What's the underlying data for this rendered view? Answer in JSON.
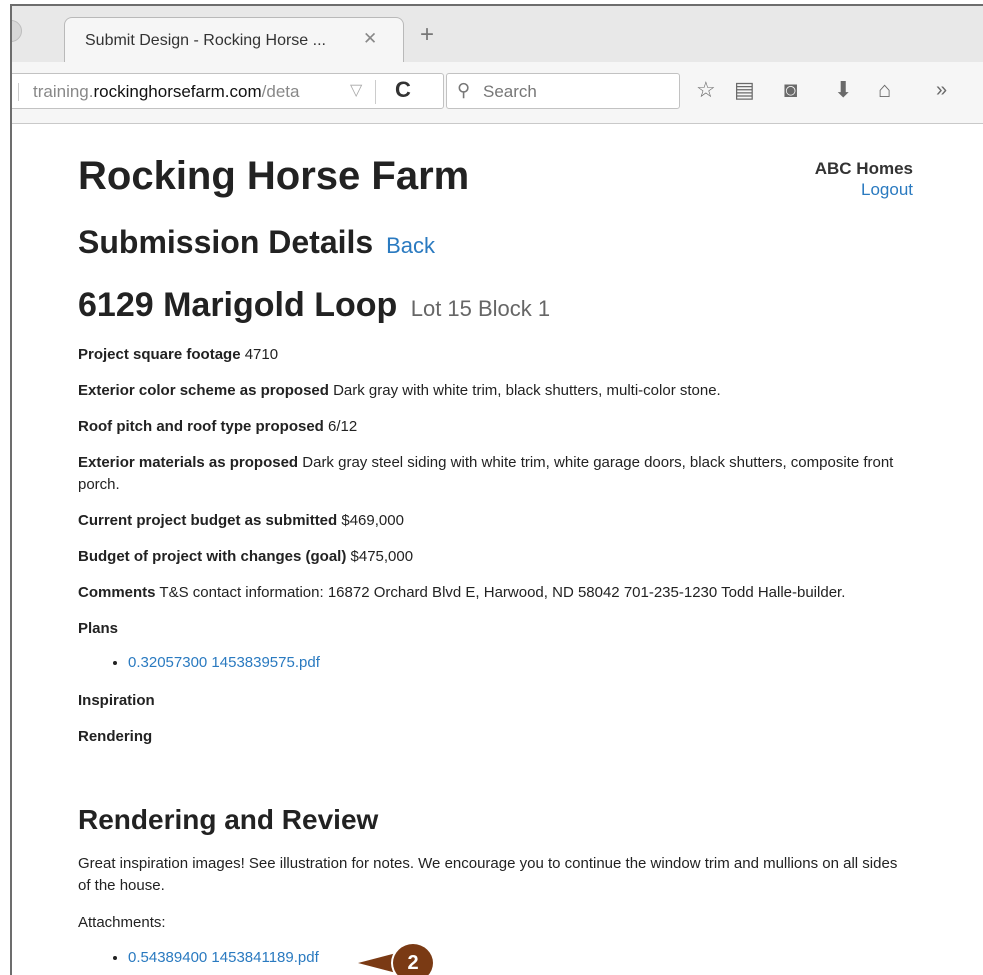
{
  "browser": {
    "tab_title": "Submit Design - Rocking Horse ...",
    "tab_close": "✕",
    "new_tab": "+",
    "url_prefix": "training.",
    "url_domain": "rockinghorsefarm.com",
    "url_suffix": "/deta",
    "search_placeholder": "Search",
    "more": "»"
  },
  "header": {
    "site_title": "Rocking Horse Farm",
    "user_name": "ABC Homes",
    "logout_label": "Logout"
  },
  "submission": {
    "heading": "Submission Details",
    "back_label": "Back",
    "address": "6129 Marigold Loop",
    "lot": "Lot 15 Block 1"
  },
  "fields": [
    {
      "label": "Project square footage",
      "value": "4710"
    },
    {
      "label": "Exterior color scheme as proposed",
      "value": "Dark gray with white trim, black shutters, multi-color stone."
    },
    {
      "label": "Roof pitch and roof type proposed",
      "value": "6/12"
    },
    {
      "label": "Exterior materials as proposed",
      "value": "Dark gray steel siding with white trim, white garage doors, black shutters, composite front porch."
    },
    {
      "label": "Current project budget as submitted",
      "value": "$469,000"
    },
    {
      "label": "Budget of project with changes (goal)",
      "value": "$475,000"
    },
    {
      "label": "Comments",
      "value": "T&S contact information: 16872 Orchard Blvd E, Harwood, ND 58042 701-235-1230 Todd Halle-builder."
    }
  ],
  "plans": {
    "label": "Plans",
    "files": [
      "0.32057300 1453839575.pdf"
    ]
  },
  "inspiration_label": "Inspiration",
  "rendering_label": "Rendering",
  "review": {
    "heading": "Rendering and Review",
    "text": "Great inspiration images! See illustration for notes. We encourage you to continue the window trim and mullions on all sides of the house.",
    "attachments_label": "Attachments:",
    "attachments": [
      "0.54389400 1453841189.pdf"
    ]
  },
  "callout": {
    "number": "2",
    "color": "#7a3a14"
  },
  "colors": {
    "link": "#2a7ac0"
  }
}
